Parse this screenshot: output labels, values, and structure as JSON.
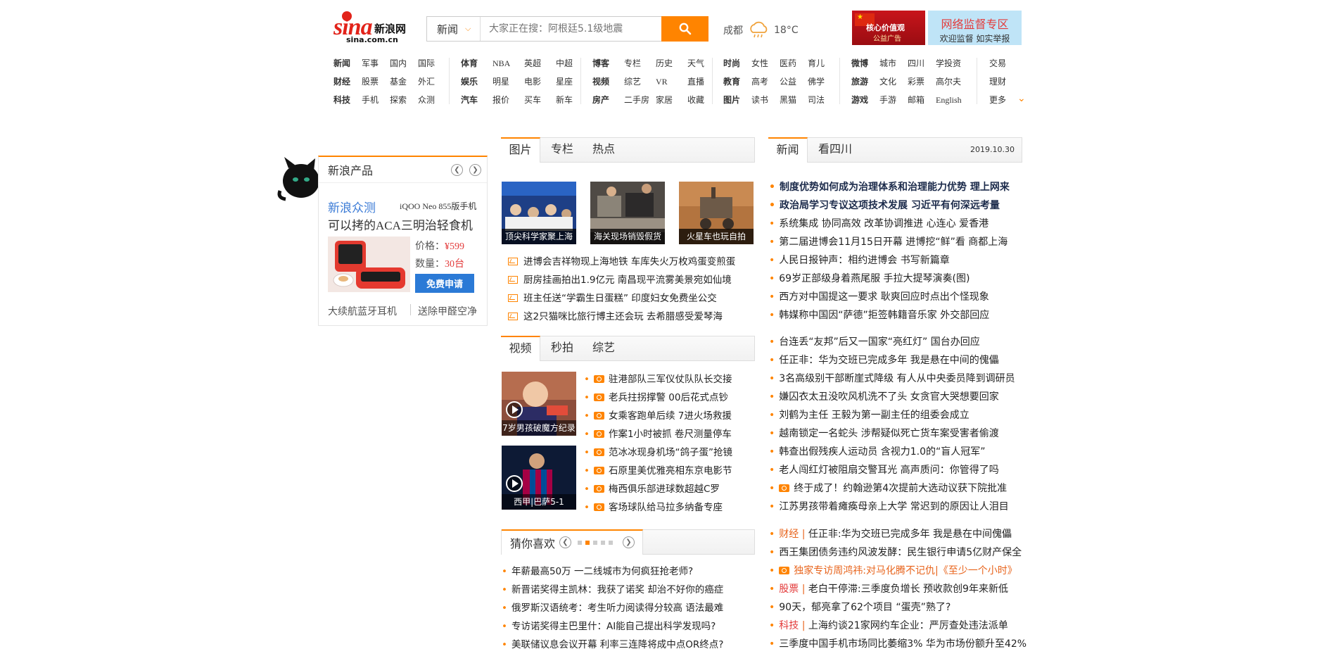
{
  "logo": {
    "mark": "sina",
    "cn": "新浪网",
    "domain": "sina.com.cn"
  },
  "search": {
    "category": "新闻",
    "placeholder": "大家正在搜：阿根廷5.1级地震"
  },
  "weather": {
    "city": "成都",
    "temp": "18°C"
  },
  "ads": {
    "left": {
      "line1": "核心价值观",
      "line2": "公益广告"
    },
    "right": {
      "title": "网络监督专区",
      "subtitle": "欢迎监督 如实举报"
    }
  },
  "nav": [
    {
      "rows": [
        [
          "新闻",
          "军事",
          "国内",
          "国际"
        ],
        [
          "财经",
          "股票",
          "基金",
          "外汇"
        ],
        [
          "科技",
          "手机",
          "探索",
          "众测"
        ]
      ],
      "bold_first": true
    },
    {
      "rows": [
        [
          "体育",
          "NBA",
          "英超",
          "中超"
        ],
        [
          "娱乐",
          "明星",
          "电影",
          "星座"
        ],
        [
          "汽车",
          "报价",
          "买车",
          "新车"
        ]
      ],
      "bold_first": true
    },
    {
      "rows": [
        [
          "博客",
          "专栏",
          "历史",
          "天气"
        ],
        [
          "视频",
          "综艺",
          "VR",
          "直播"
        ],
        [
          "房产",
          "二手房",
          "家居",
          "收藏"
        ]
      ],
      "bold_first": true
    },
    {
      "rows": [
        [
          "时尚",
          "女性",
          "医药",
          "育儿"
        ],
        [
          "教育",
          "高考",
          "公益",
          "佛学"
        ],
        [
          "图片",
          "读书",
          "黑猫",
          "司法"
        ]
      ],
      "bold_first": true
    },
    {
      "rows": [
        [
          "微博",
          "城市",
          "四川",
          "学投资"
        ],
        [
          "旅游",
          "文化",
          "彩票",
          "高尔夫"
        ],
        [
          "游戏",
          "手游",
          "邮箱",
          "English"
        ]
      ],
      "bold_first": true
    },
    {
      "rows": [
        [
          "交易"
        ],
        [
          "理财"
        ],
        [
          "更多"
        ]
      ],
      "bold_first": false
    }
  ],
  "product_panel": {
    "title": "新浪产品",
    "zc_title": "新浪众测",
    "zc_model": "iQOO Neo 855版手机",
    "zc_desc": "可以拷的ACA三明治轻食机",
    "price_label": "价格：",
    "price": "¥599",
    "qty_label": "数量：",
    "qty": "30台",
    "apply": "免费申请",
    "foot_left": "大续航蓝牙耳机",
    "foot_right": "送除甲醛空净"
  },
  "pic_tabs": [
    "图片",
    "专栏",
    "热点"
  ],
  "pics": [
    {
      "caption": "顶尖科学家聚上海"
    },
    {
      "caption": "海关现场销毁假货"
    },
    {
      "caption": "火星车也玩自拍"
    }
  ],
  "pic_news": [
    "进博会吉祥物现上海地铁 车库失火万枚鸡蛋变煎蛋",
    "厨房挂画拍出1.9亿元 南昌现平流雾美景宛如仙境",
    "班主任送“学霸生日蛋糕” 印度妇女免费坐公交",
    "这2只猫咪比旅行博主还会玩 去希腊感受爱琴海"
  ],
  "video_tabs": [
    "视频",
    "秒拍",
    "综艺"
  ],
  "video_thumbs": [
    {
      "caption": "7岁男孩破魔方纪录"
    },
    {
      "caption": "西甲|巴萨5-1"
    }
  ],
  "video_news": [
    "驻港部队三军仪仗队队长交接",
    "老兵拄拐撑警 00后花式点钞",
    "女乘客跑单后续 7进火场救援",
    "作案1小时被抓 卷尺测量停车",
    "范冰冰现身机场“鸽子蛋”抢镜",
    "石原里美优雅亮相东京电影节",
    "梅西俱乐部进球数超越C罗",
    "客场球队给马拉多纳备专座"
  ],
  "guess": {
    "title": "猜你喜欢",
    "items": [
      "年薪最高50万 一二线城市为何疯狂抢老师?",
      "新晋诺奖得主凯林：我获了诺奖 却治不好你的癌症",
      "俄罗斯汉语统考：考生听力阅读得分较高 语法最难",
      "专访诺奖得主巴里什：AI能自己提出科学发现吗?",
      "美联储议息会议开幕 利率三连降将成中点OR终点?"
    ]
  },
  "news_tabs": [
    "新闻",
    "看四川"
  ],
  "news_date": "2019.10.30",
  "news_block1": [
    {
      "text": "制度优势如何成为治理体系和治理能力优势 理上网来",
      "bold": true
    },
    {
      "text": "政治局学习专议这项技术发展 习近平有何深远考量",
      "bold": true
    },
    {
      "text": "系统集成 协同高效 改革协调推进 心连心 爱香港",
      "bold": false
    },
    {
      "text": "第二届进博会11月15日开幕 进博挖“鲜”看 商都上海",
      "bold": false
    },
    {
      "text": "人民日报钟声：相约进博会 书写新篇章",
      "bold": false
    },
    {
      "text": "69岁正部级身着燕尾服 手拉大提琴演奏(图)",
      "bold": false
    },
    {
      "text": "西方对中国提这一要求 耿爽回应时点出个怪现象",
      "bold": false
    },
    {
      "text": "韩媒称中国因“萨德”拒签韩籍音乐家 外交部回应",
      "bold": false
    }
  ],
  "news_block2": [
    {
      "text": "台连丢“友邦”后又一国家“亮红灯” 国台办回应"
    },
    {
      "text": "任正非：华为交班已完成多年 我是悬在中间的傀儡"
    },
    {
      "text": "3名高级别干部断崖式降级 有人从中央委员降到调研员"
    },
    {
      "text": "嫌囚衣太丑没吹风机洗不了头 女贪官大哭想要回家"
    },
    {
      "text": "刘鹤为主任 王毅为第一副主任的组委会成立"
    },
    {
      "text": "越南锁定一名蛇头 涉帮疑似死亡货车案受害者偷渡"
    },
    {
      "text": "韩查出假残疾人运动员 含视力1.0的“盲人冠军”"
    },
    {
      "text": "老人闯红灯被阻扇交警耳光 高声质问：你管得了吗"
    },
    {
      "text": "终于成了！约翰逊第4次提前大选动议获下院批准",
      "video": true
    },
    {
      "text": "江苏男孩带着瘫痪母亲上大学 常迟到的原因让人泪目"
    }
  ],
  "news_block3": [
    {
      "label": "财经",
      "text": "任正非:华为交班已完成多年 我是悬在中间傀儡"
    },
    {
      "label": "",
      "text": "西王集团债务违约风波发酵：民生银行申请5亿财产保全"
    },
    {
      "label": "",
      "text": "独家专访周鸿祎:对马化腾不记仇|《至少一个小时》",
      "video": true,
      "orange": true
    },
    {
      "label": "股票",
      "text": "老白干停滞:三季度负增长 预收款创9年来新低"
    },
    {
      "label": "",
      "text": "90天，郁亮拿了62个项目 “蛋壳”熟了?"
    },
    {
      "label": "科技",
      "text": "上海约谈21家网约车企业：严厉查处违法派单"
    },
    {
      "label": "",
      "text": "三季度中国手机市场同比萎缩3% 华为市场份额升至42%"
    }
  ]
}
